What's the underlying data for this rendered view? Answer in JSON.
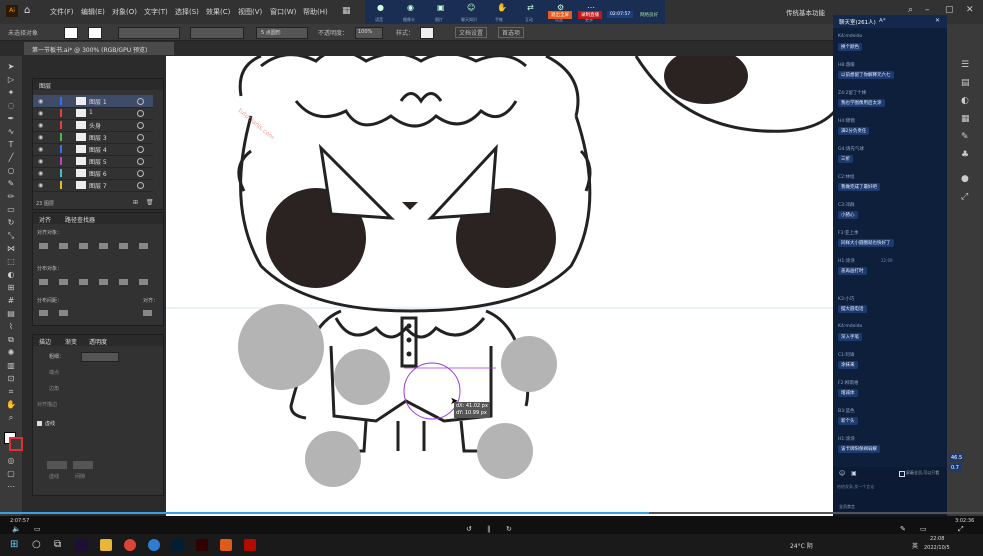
{
  "menu": {
    "items": [
      "文件(F)",
      "编辑(E)",
      "对象(O)",
      "文字(T)",
      "选择(S)",
      "效果(C)",
      "视图(V)",
      "窗口(W)",
      "帮助(H)"
    ],
    "workspace": "传统基本功能",
    "meeting_icons": [
      "语音",
      "摄像头",
      "图片",
      "聊天知识",
      "手推",
      "互动",
      "设置",
      "更多"
    ],
    "badge1": "退出全屏",
    "badge2": "录制直播",
    "time_label": "02:07:57",
    "network": "网络良好"
  },
  "control_bar": {
    "no_selection": "未选择对象",
    "stroke_value": "5 点圆形",
    "opacity_label": "不透明度：",
    "opacity_value": "100%",
    "style_label": "样式：",
    "doc_settings": "文档设置",
    "preferences": "首选项"
  },
  "document": {
    "tab_title": "第一节板书.ai* @ 300% (RGB/GPU 预览)"
  },
  "layers_panel": {
    "title": "图层",
    "rows": [
      {
        "name": "图层 1",
        "color": "#3a6df0"
      },
      {
        "name": "1",
        "color": "#e04040"
      },
      {
        "name": "头身",
        "color": "#e04040"
      },
      {
        "name": "图层 3",
        "color": "#4db84d"
      },
      {
        "name": "图层 4",
        "color": "#3a6df0"
      },
      {
        "name": "图层 5",
        "color": "#c040c0"
      },
      {
        "name": "图层 6",
        "color": "#40c0c0"
      },
      {
        "name": "图层 7",
        "color": "#e0c030"
      }
    ],
    "footer": "23 图层"
  },
  "align_panel": {
    "tabs": [
      "对齐",
      "路径查找器"
    ],
    "align_objects": "对齐对象：",
    "distribute_objects": "分布对象：",
    "distribute_spacing": "分布间距：",
    "align_to": "对齐："
  },
  "stroke_panel": {
    "tabs": [
      "描边",
      "渐变",
      "透明度"
    ],
    "weight_label": "粗细：",
    "cap": "端点",
    "corner": "边角",
    "align_stroke": "对齐描边",
    "dashed": "虚线",
    "dash": "虚线",
    "gap": "间隙"
  },
  "canvas": {
    "tooltip_dx": "dX: 41.02 px",
    "tooltip_dy": "dY: 10.99 px",
    "watermark": "tutor.lanjs.com"
  },
  "chat": {
    "title": "聊天室(261人)",
    "font_label": "A*",
    "messages": [
      {
        "user": "K4:mdeido",
        "text": "换个颜色"
      },
      {
        "user": "H8:落暖",
        "text": "以前想留了你解释元六七"
      },
      {
        "user": "Z4:2留了个棒",
        "text": "我也学图像用后太涂"
      },
      {
        "user": "H4:锦锦",
        "text": "满2分负责任"
      },
      {
        "user": "G4:请先气球",
        "text": "三折"
      },
      {
        "user": "C2:林绘",
        "text": "我做完成了最好吧"
      },
      {
        "user": "C3:邓群",
        "text": "小猪心"
      },
      {
        "user": "F3:亚上季",
        "text": "同样大小圆圈就也快好了"
      },
      {
        "user": "H1:涂涂",
        "text": "盖再画打时"
      },
      {
        "user": "K3:小巧",
        "text": "摆大圆电话"
      },
      {
        "user": "K4:mdeido",
        "text": "深入手笔"
      },
      {
        "user": "C1:阿锋",
        "text": "涂抹来"
      },
      {
        "user": "F2:柳雨格",
        "text": "增减体"
      },
      {
        "user": "B3:蓝色",
        "text": "新个头"
      },
      {
        "user": "H1:涂涂",
        "text": "该卡牌阳保阀弱解"
      }
    ],
    "time_stamp": "22:09",
    "input_placeholder": "给他发条,发一个言论",
    "only_teacher": "屏蔽全员,可以只看",
    "send": "发送",
    "all_ban": "全员禁言"
  },
  "zoom_badges": [
    "46.5",
    "0.7"
  ],
  "video": {
    "elapsed": "2:07:57",
    "total": "3:02:36",
    "progress": 0.66
  },
  "taskbar": {
    "weather": "24°C 阴",
    "time": "22:08",
    "date": "2022/10/5",
    "lang": "英"
  }
}
